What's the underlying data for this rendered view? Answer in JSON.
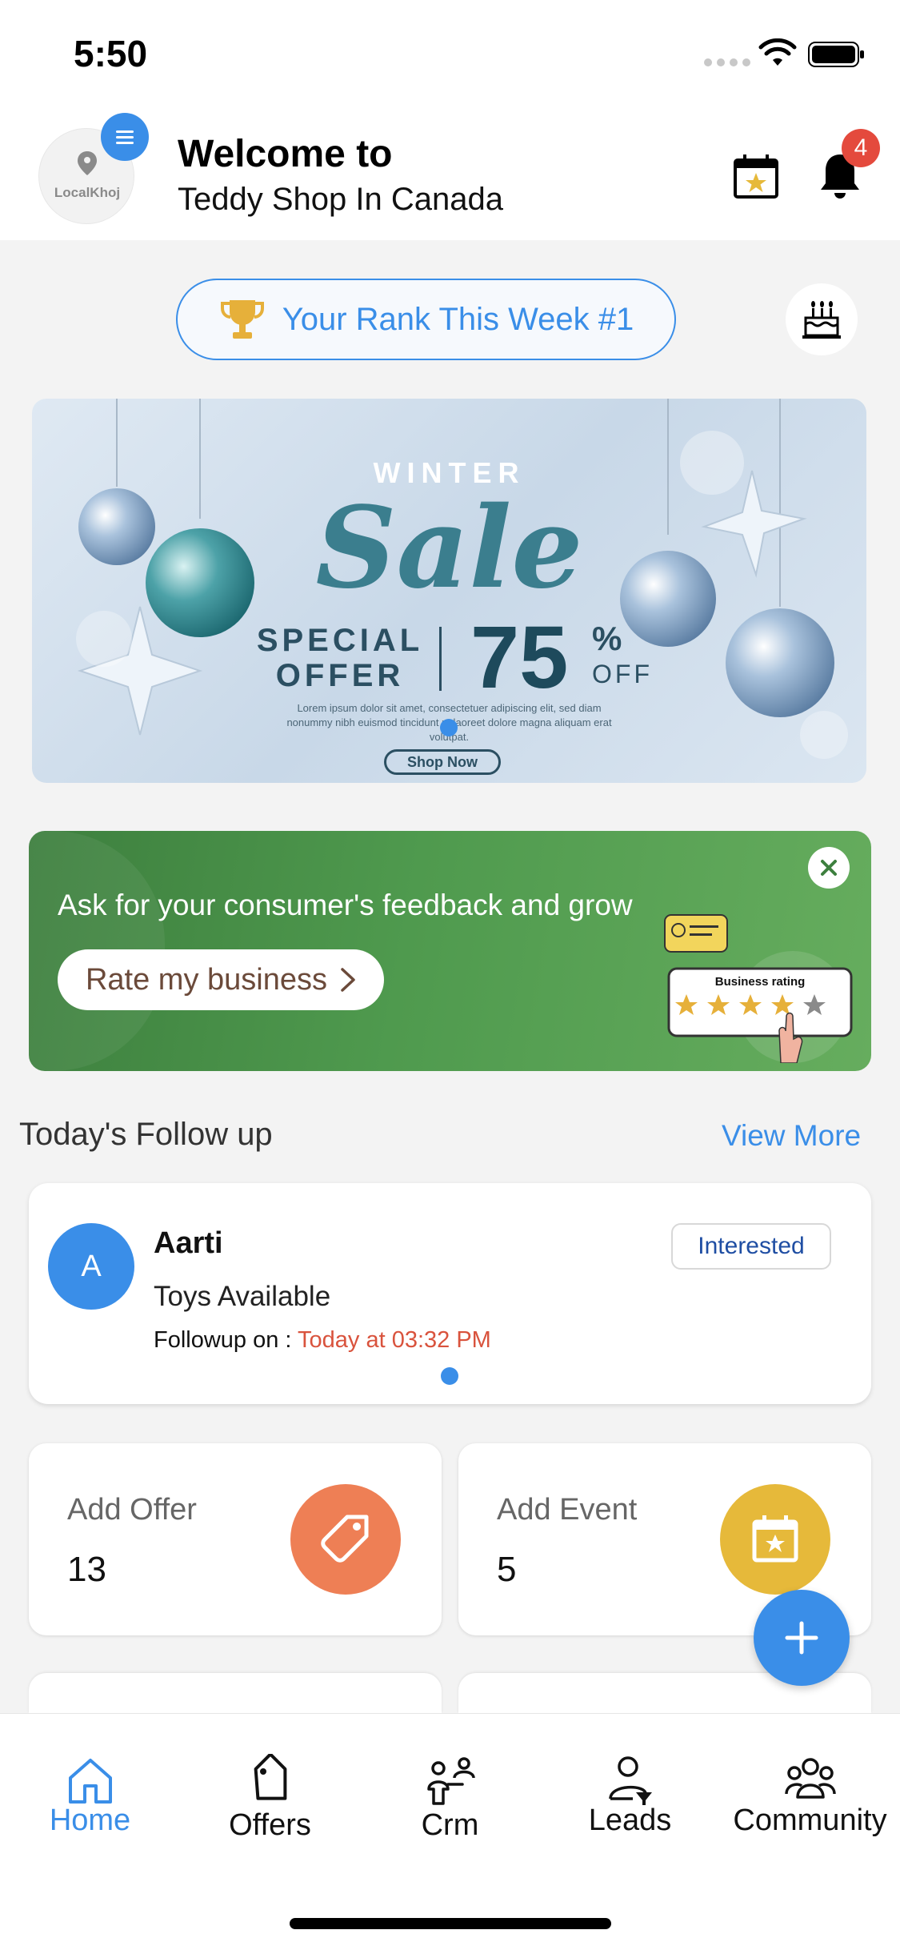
{
  "status_bar": {
    "time": "5:50"
  },
  "header": {
    "logo_text": "LocalKhoj",
    "welcome_title": "Welcome to",
    "shop_name": "Teddy Shop In Canada",
    "notification_count": "4"
  },
  "rank": {
    "label": "Your Rank This Week #1"
  },
  "banner": {
    "winter": "WINTER",
    "sale": "Sale",
    "special_offer": "SPECIAL OFFER",
    "discount": "75",
    "percent": "%",
    "off": "OFF",
    "lorem": "Lorem ipsum dolor sit amet, consectetuer adipiscing elit, sed diam nonummy nibh euismod tincidunt ut laoreet dolore magna aliquam erat volutpat.",
    "shop_now": "Shop Now"
  },
  "feedback": {
    "text": "Ask for your consumer's feedback and grow",
    "button_label": "Rate my business",
    "illustration_label": "Business rating",
    "stars_filled": 4,
    "stars_total": 5
  },
  "followup_section": {
    "title": "Today's Follow up",
    "view_more": "View More",
    "card": {
      "avatar_letter": "A",
      "name": "Aarti",
      "status": "Interested",
      "description": "Toys Available",
      "followup_prefix": "Followup on : ",
      "followup_time": "Today at 03:32 PM"
    }
  },
  "stats": [
    {
      "label": "Add Offer",
      "value": "13",
      "icon": "tag-icon",
      "color": "#ee7f55"
    },
    {
      "label": "Add Event",
      "value": "5",
      "icon": "calendar-star-icon",
      "color": "#e6b93a"
    }
  ],
  "bottom_nav": [
    {
      "label": "Home",
      "icon": "home-icon",
      "active": true
    },
    {
      "label": "Offers",
      "icon": "tag-icon",
      "active": false
    },
    {
      "label": "Crm",
      "icon": "crm-icon",
      "active": false
    },
    {
      "label": "Leads",
      "icon": "leads-icon",
      "active": false
    },
    {
      "label": "Community",
      "icon": "community-icon",
      "active": false
    }
  ],
  "colors": {
    "accent": "#3a8ee8",
    "badge_red": "#e44a3d",
    "feedback_green": "#4f9a4e",
    "followup_time": "#d9533d"
  }
}
